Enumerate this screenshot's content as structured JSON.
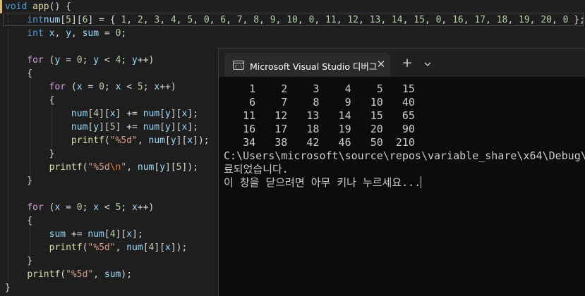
{
  "editor": {
    "lines": [
      [
        [
          "kw",
          "void"
        ],
        [
          "",
          "void_sp"
        ],
        [
          "fn",
          "app"
        ],
        [
          "",
          "() {"
        ]
      ],
      [
        [
          "",
          "    "
        ],
        [
          "kw",
          "int"
        ],
        [
          "",
          ""
        ],
        [
          "var",
          "num"
        ],
        [
          "",
          "["
        ],
        [
          "num",
          "5"
        ],
        [
          "",
          "]["
        ],
        [
          "num",
          "6"
        ],
        [
          "",
          "] = { "
        ],
        [
          "num",
          "1"
        ],
        [
          "",
          ", "
        ],
        [
          "num",
          "2"
        ],
        [
          "",
          ", "
        ],
        [
          "num",
          "3"
        ],
        [
          "",
          ", "
        ],
        [
          "num",
          "4"
        ],
        [
          "",
          ", "
        ],
        [
          "num",
          "5"
        ],
        [
          "",
          ", "
        ],
        [
          "num",
          "0"
        ],
        [
          "",
          ", "
        ],
        [
          "num",
          "6"
        ],
        [
          "",
          ", "
        ],
        [
          "num",
          "7"
        ],
        [
          "",
          ", "
        ],
        [
          "num",
          "8"
        ],
        [
          "",
          ", "
        ],
        [
          "num",
          "9"
        ],
        [
          "",
          ", "
        ],
        [
          "num",
          "10"
        ],
        [
          "",
          ", "
        ],
        [
          "num",
          "0"
        ],
        [
          "",
          ", "
        ],
        [
          "num",
          "11"
        ],
        [
          "",
          ", "
        ],
        [
          "num",
          "12"
        ],
        [
          "",
          ", "
        ],
        [
          "num",
          "13"
        ],
        [
          "",
          ", "
        ],
        [
          "num",
          "14"
        ],
        [
          "",
          ", "
        ],
        [
          "num",
          "15"
        ],
        [
          "",
          ", "
        ],
        [
          "num",
          "0"
        ],
        [
          "",
          ", "
        ],
        [
          "num",
          "16"
        ],
        [
          "",
          ", "
        ],
        [
          "num",
          "17"
        ],
        [
          "",
          ", "
        ],
        [
          "num",
          "18"
        ],
        [
          "",
          ", "
        ],
        [
          "num",
          "19"
        ],
        [
          "",
          ", "
        ],
        [
          "num",
          "20"
        ],
        [
          "",
          ", "
        ],
        [
          "num",
          "0"
        ],
        [
          "",
          " };"
        ]
      ],
      [
        [
          "",
          "    "
        ],
        [
          "kw",
          "int"
        ],
        [
          "",
          " "
        ],
        [
          "var",
          "x"
        ],
        [
          "",
          ", "
        ],
        [
          "var",
          "y"
        ],
        [
          "",
          ", "
        ],
        [
          "var",
          "sum"
        ],
        [
          "",
          " = "
        ],
        [
          "num",
          "0"
        ],
        [
          "",
          ";"
        ]
      ],
      [
        [
          "",
          ""
        ]
      ],
      [
        [
          "",
          "    "
        ],
        [
          "ctl",
          "for"
        ],
        [
          "",
          " ("
        ],
        [
          "var",
          "y"
        ],
        [
          "",
          " = "
        ],
        [
          "num",
          "0"
        ],
        [
          "",
          "; "
        ],
        [
          "var",
          "y"
        ],
        [
          "",
          " < "
        ],
        [
          "num",
          "4"
        ],
        [
          "",
          "; "
        ],
        [
          "var",
          "y"
        ],
        [
          "",
          "++)"
        ]
      ],
      [
        [
          "",
          "    {"
        ]
      ],
      [
        [
          "",
          "        "
        ],
        [
          "ctl",
          "for"
        ],
        [
          "",
          " ("
        ],
        [
          "var",
          "x"
        ],
        [
          "",
          " = "
        ],
        [
          "num",
          "0"
        ],
        [
          "",
          "; "
        ],
        [
          "var",
          "x"
        ],
        [
          "",
          " < "
        ],
        [
          "num",
          "5"
        ],
        [
          "",
          "; "
        ],
        [
          "var",
          "x"
        ],
        [
          "",
          "++)"
        ]
      ],
      [
        [
          "",
          "        {"
        ]
      ],
      [
        [
          "",
          "            "
        ],
        [
          "var",
          "num"
        ],
        [
          "",
          "["
        ],
        [
          "num",
          "4"
        ],
        [
          "",
          "]["
        ],
        [
          "var",
          "x"
        ],
        [
          "",
          "] += "
        ],
        [
          "var",
          "num"
        ],
        [
          "",
          "["
        ],
        [
          "var",
          "y"
        ],
        [
          "",
          "]["
        ],
        [
          "var",
          "x"
        ],
        [
          "",
          "];"
        ]
      ],
      [
        [
          "",
          "            "
        ],
        [
          "var",
          "num"
        ],
        [
          "",
          "["
        ],
        [
          "var",
          "y"
        ],
        [
          "",
          "]["
        ],
        [
          "num",
          "5"
        ],
        [
          "",
          "] += "
        ],
        [
          "var",
          "num"
        ],
        [
          "",
          "["
        ],
        [
          "var",
          "y"
        ],
        [
          "",
          "]["
        ],
        [
          "var",
          "x"
        ],
        [
          "",
          "];"
        ]
      ],
      [
        [
          "",
          "            "
        ],
        [
          "fn",
          "printf"
        ],
        [
          "",
          "("
        ],
        [
          "str",
          "\"%5d\""
        ],
        [
          "",
          ", "
        ],
        [
          "var",
          "num"
        ],
        [
          "",
          "["
        ],
        [
          "var",
          "y"
        ],
        [
          "",
          "]["
        ],
        [
          "var",
          "x"
        ],
        [
          "",
          "]);"
        ]
      ],
      [
        [
          "",
          "        }"
        ]
      ],
      [
        [
          "",
          "        "
        ],
        [
          "fn",
          "printf"
        ],
        [
          "",
          "("
        ],
        [
          "str",
          "\"%5d"
        ],
        [
          "esc",
          "\\n"
        ],
        [
          "str",
          "\""
        ],
        [
          "",
          ", "
        ],
        [
          "var",
          "num"
        ],
        [
          "",
          "["
        ],
        [
          "var",
          "y"
        ],
        [
          "",
          "]["
        ],
        [
          "num",
          "5"
        ],
        [
          "",
          "]);"
        ]
      ],
      [
        [
          "",
          "    }"
        ]
      ],
      [
        [
          "",
          ""
        ]
      ],
      [
        [
          "",
          "    "
        ],
        [
          "ctl",
          "for"
        ],
        [
          "",
          " ("
        ],
        [
          "var",
          "x"
        ],
        [
          "",
          " = "
        ],
        [
          "num",
          "0"
        ],
        [
          "",
          "; "
        ],
        [
          "var",
          "x"
        ],
        [
          "",
          " < "
        ],
        [
          "num",
          "5"
        ],
        [
          "",
          "; "
        ],
        [
          "var",
          "x"
        ],
        [
          "",
          "++)"
        ]
      ],
      [
        [
          "",
          "    {"
        ]
      ],
      [
        [
          "",
          "        "
        ],
        [
          "var",
          "sum"
        ],
        [
          "",
          " += "
        ],
        [
          "var",
          "num"
        ],
        [
          "",
          "["
        ],
        [
          "num",
          "4"
        ],
        [
          "",
          "]["
        ],
        [
          "var",
          "x"
        ],
        [
          "",
          "];"
        ]
      ],
      [
        [
          "",
          "        "
        ],
        [
          "fn",
          "printf"
        ],
        [
          "",
          "("
        ],
        [
          "str",
          "\"%5d\""
        ],
        [
          "",
          ", "
        ],
        [
          "var",
          "num"
        ],
        [
          "",
          "["
        ],
        [
          "num",
          "4"
        ],
        [
          "",
          "]["
        ],
        [
          "var",
          "x"
        ],
        [
          "",
          "]);"
        ]
      ],
      [
        [
          "",
          "    }"
        ]
      ],
      [
        [
          "",
          "    "
        ],
        [
          "fn",
          "printf"
        ],
        [
          "",
          "("
        ],
        [
          "str",
          "\"%5d\""
        ],
        [
          "",
          ", "
        ],
        [
          "var",
          "sum"
        ],
        [
          "",
          ");"
        ]
      ],
      [
        [
          "",
          "}"
        ]
      ]
    ]
  },
  "terminal": {
    "tab_title": "Microsoft Visual Studio 디버그",
    "tab_icon": "terminal-icon",
    "close_label": "✕",
    "new_tab_label": "+",
    "output_lines": [
      "    1    2    3    4    5   15",
      "    6    7    8    9   10   40",
      "   11   12   13   14   15   65",
      "   16   17   18   19   20   90",
      "   34   38   42   46   50  210",
      "C:\\Users\\microsoft\\source\\repos\\variable_share\\x64\\Debug\\",
      "료되었습니다.",
      "이 창을 닫으려면 아무 키나 누르세요..."
    ]
  },
  "colors": {
    "editor_bg": "#1e1e1e",
    "terminal_bg": "#0c0c0c",
    "keyword": "#569cd6",
    "control": "#d8a0df",
    "function": "#dcdcaa",
    "number": "#b5cea8",
    "variable": "#9cdcfe",
    "string": "#d69d85"
  }
}
